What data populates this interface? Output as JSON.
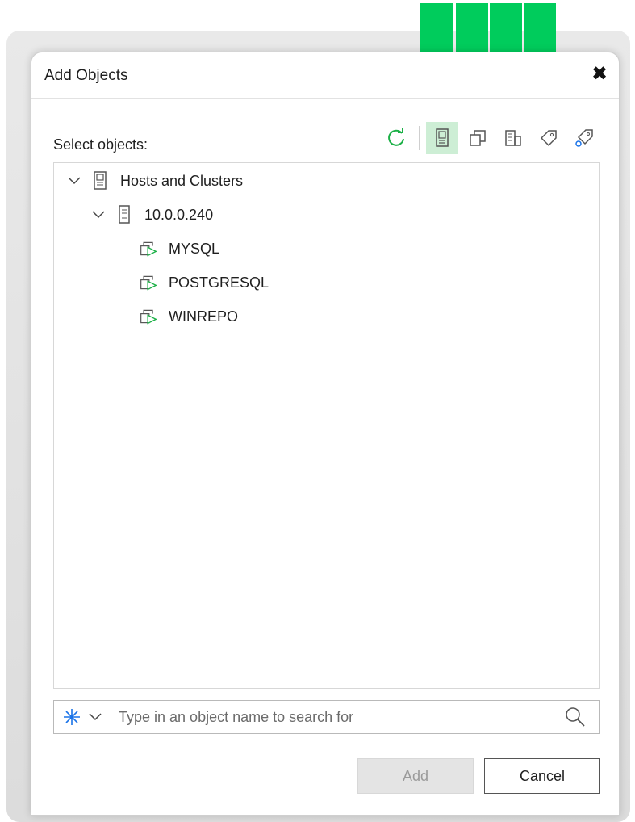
{
  "dialog": {
    "title": "Add Objects",
    "close_glyph": "✖"
  },
  "picker": {
    "label": "Select objects:",
    "toolbar": [
      {
        "icon": "refresh-icon",
        "active": false
      },
      {
        "icon": "hosts-and-clusters-icon",
        "active": true
      },
      {
        "icon": "vms-and-templates-icon",
        "active": false
      },
      {
        "icon": "datastores-icon",
        "active": false
      },
      {
        "icon": "tag-icon",
        "active": false
      },
      {
        "icon": "tag-category-icon",
        "active": false
      }
    ],
    "accent_color": "#1bb046",
    "active_bg_color": "#cdeed5"
  },
  "tree": {
    "root": {
      "label": "Hosts and Clusters",
      "icon": "server-stack-icon",
      "expanded": true
    },
    "host": {
      "label": "10.0.0.240",
      "icon": "server-icon",
      "expanded": true
    },
    "vms": [
      {
        "label": "MYSQL",
        "icon": "vm-icon"
      },
      {
        "label": "POSTGRESQL",
        "icon": "vm-icon"
      },
      {
        "label": "WINREPO",
        "icon": "vm-icon"
      }
    ]
  },
  "search": {
    "placeholder": "Type in an object name to search for",
    "value": ""
  },
  "buttons": {
    "add": "Add",
    "cancel": "Cancel"
  },
  "callout": {
    "color": "#00cc5c",
    "count": 4
  }
}
